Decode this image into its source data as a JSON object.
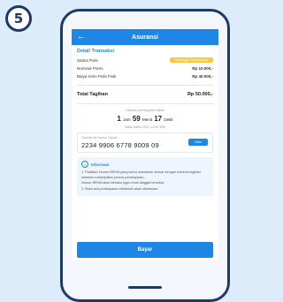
{
  "step": "5",
  "app": {
    "title": "Asuransi",
    "back_icon": "arrow-left-icon"
  },
  "detail": {
    "section_title": "Detail Transaksi",
    "rows": [
      {
        "label": "Status Polis",
        "value": "Menunggu Pembayaran",
        "type": "badge"
      },
      {
        "label": "Nominal Premi",
        "value": "Rp 10.000,-"
      },
      {
        "label": "Biaya Kirim Polis Fisik",
        "value": "Rp 40.000,-"
      }
    ],
    "total_label": "Total Tagihan",
    "total_value": "Rp 50.000,-"
  },
  "timer": {
    "hint": "Lakukan pembayaran dalam",
    "hours": "1",
    "hours_unit": "Jam",
    "minutes": "59",
    "minutes_unit": "Menit",
    "seconds": "17",
    "seconds_unit": "Detik",
    "deadline": "batas waktu 2019, 15:09 WIB"
  },
  "virtual_account": {
    "label": "Transfer ke Nomor Tujuan",
    "number": "2234 9906 6778 9009 09",
    "copy_label": "Salin"
  },
  "info": {
    "title": "Informasi",
    "items": [
      "1. Pastikan Nomor BRIVA yang kamu masukkan sesuai dengan nominal tagihan sebelum melanjutkan proses pembayaran.",
      "   Nomor BRIVA akan berlaku juga untuk tanggal tersebut.",
      "2. Bukti asli pembayaran elektronik akan dikirimkan."
    ]
  },
  "pay_button": "Bayar",
  "colors": {
    "primary": "#1e87e5",
    "badge": "#f7c940",
    "frame": "#1d3a66",
    "background": "#dcecfa"
  }
}
